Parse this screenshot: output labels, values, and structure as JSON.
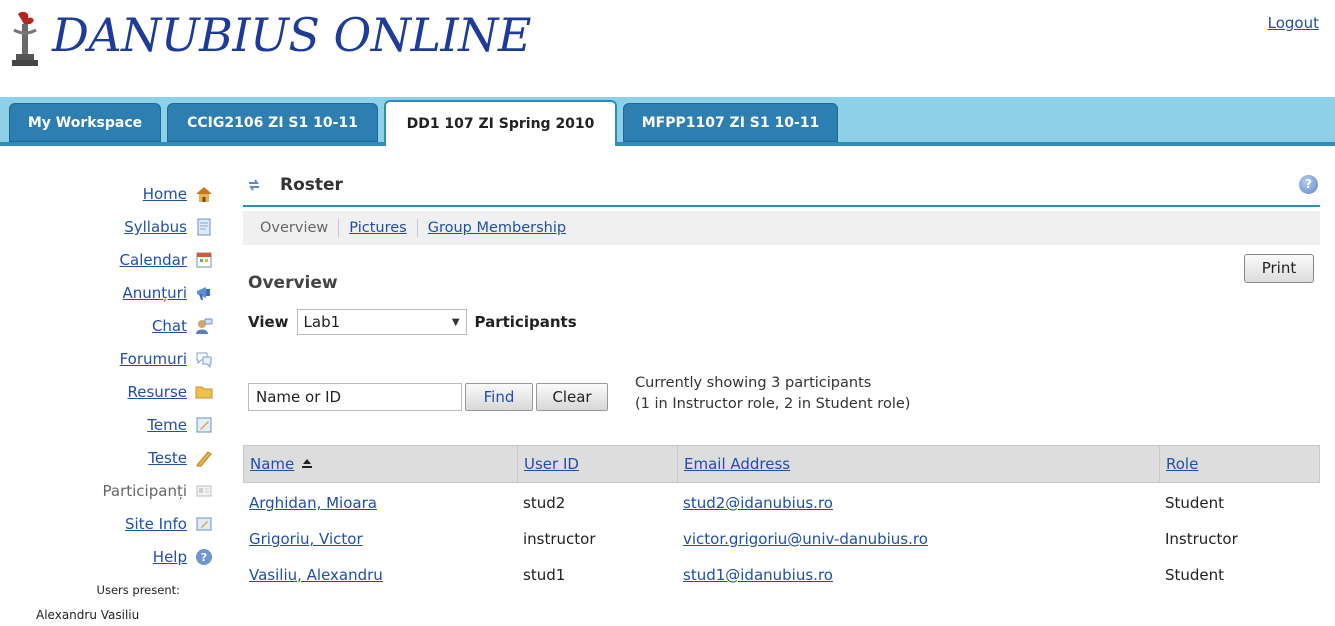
{
  "header": {
    "logo_text": "DANUBIUS ONLINE",
    "logout_label": "Logout"
  },
  "tabs": [
    {
      "label": "My Workspace",
      "active": false
    },
    {
      "label": "CCIG2106 ZI S1 10-11",
      "active": false
    },
    {
      "label": "DD1 107 ZI Spring 2010",
      "active": true
    },
    {
      "label": "MFPP1107 ZI S1 10-11",
      "active": false
    }
  ],
  "sidebar": {
    "items": [
      {
        "label": "Home",
        "icon": "home-icon"
      },
      {
        "label": "Syllabus",
        "icon": "syllabus-icon"
      },
      {
        "label": "Calendar",
        "icon": "calendar-icon"
      },
      {
        "label": "Anunțuri",
        "icon": "announcements-icon"
      },
      {
        "label": "Chat",
        "icon": "chat-icon"
      },
      {
        "label": "Forumuri",
        "icon": "forums-icon"
      },
      {
        "label": "Resurse",
        "icon": "folder-icon"
      },
      {
        "label": "Teme",
        "icon": "assignments-icon"
      },
      {
        "label": "Teste",
        "icon": "pencil-icon"
      },
      {
        "label": "Participanți",
        "icon": "roster-icon",
        "current": true
      },
      {
        "label": "Site Info",
        "icon": "site-info-icon"
      },
      {
        "label": "Help",
        "icon": "help-icon"
      }
    ],
    "users_present_label": "Users present:",
    "users_present": [
      "Alexandru Vasiliu"
    ]
  },
  "roster": {
    "title": "Roster",
    "subnav": {
      "overview": "Overview",
      "pictures": "Pictures",
      "group_membership": "Group Membership"
    },
    "print_label": "Print",
    "overview_heading": "Overview",
    "view_label": "View",
    "view_selected": "Lab1",
    "participants_label": "Participants",
    "search_value": "Name or ID",
    "find_label": "Find",
    "clear_label": "Clear",
    "showing_line1": "Currently showing 3 participants",
    "showing_line2": "(1 in Instructor role, 2 in Student role)",
    "columns": {
      "name": "Name",
      "user_id": "User ID",
      "email": "Email Address",
      "role": "Role"
    },
    "rows": [
      {
        "name": "Arghidan, Mioara",
        "user_id": "stud2",
        "email": "stud2@idanubius.ro",
        "role": "Student"
      },
      {
        "name": "Grigoriu, Victor",
        "user_id": "instructor",
        "email": "victor.grigoriu@univ-danubius.ro",
        "role": "Instructor"
      },
      {
        "name": "Vasiliu, Alexandru",
        "user_id": "stud1",
        "email": "stud1@idanubius.ro",
        "role": "Student"
      }
    ]
  },
  "colors": {
    "brand_blue": "#1d3b9a",
    "link": "#1f4fa8",
    "tab_bar": "#8fd0e9",
    "tab": "#2d7fb1",
    "accent_line": "#2e8cb7"
  }
}
